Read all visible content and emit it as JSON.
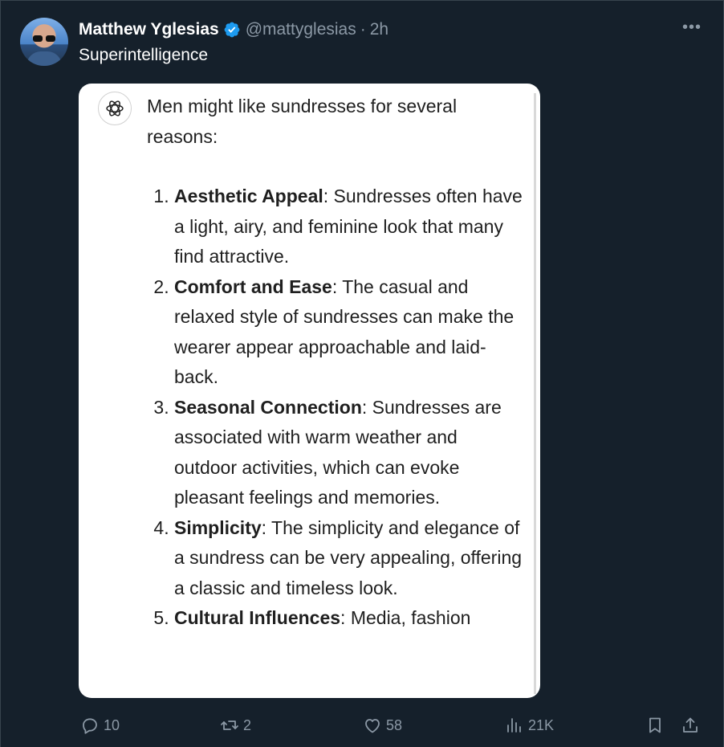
{
  "author": {
    "name": "Matthew Yglesias",
    "handle": "@mattyglesias",
    "time": "2h"
  },
  "tweet_text": "Superintelligence",
  "media": {
    "intro": "Men might like sundresses for several reasons:",
    "items": [
      {
        "title": "Aesthetic Appeal",
        "text": ": Sundresses often have a light, airy, and feminine look that many find attractive."
      },
      {
        "title": "Comfort and Ease",
        "text": ": The casual and relaxed style of sundresses can make the wearer appear approachable and laid-back."
      },
      {
        "title": "Seasonal Connection",
        "text": ": Sundresses are associated with warm weather and outdoor activities, which can evoke pleasant feelings and memories."
      },
      {
        "title": "Simplicity",
        "text": ": The simplicity and elegance of a sundress can be very appealing, offering a classic and timeless look."
      },
      {
        "title": "Cultural Influences",
        "text": ": Media, fashion"
      }
    ]
  },
  "actions": {
    "replies": "10",
    "reposts": "2",
    "likes": "58",
    "views": "21K"
  },
  "icons": {
    "more": "more-icon",
    "verified": "verified-badge-icon",
    "reply": "reply-icon",
    "repost": "repost-icon",
    "like": "like-icon",
    "views": "views-icon",
    "bookmark": "bookmark-icon",
    "share": "share-icon",
    "chatgpt": "chatgpt-logo-icon"
  },
  "colors": {
    "background": "#15202b",
    "verified": "#1d9bf0",
    "muted": "#8b98a5"
  }
}
